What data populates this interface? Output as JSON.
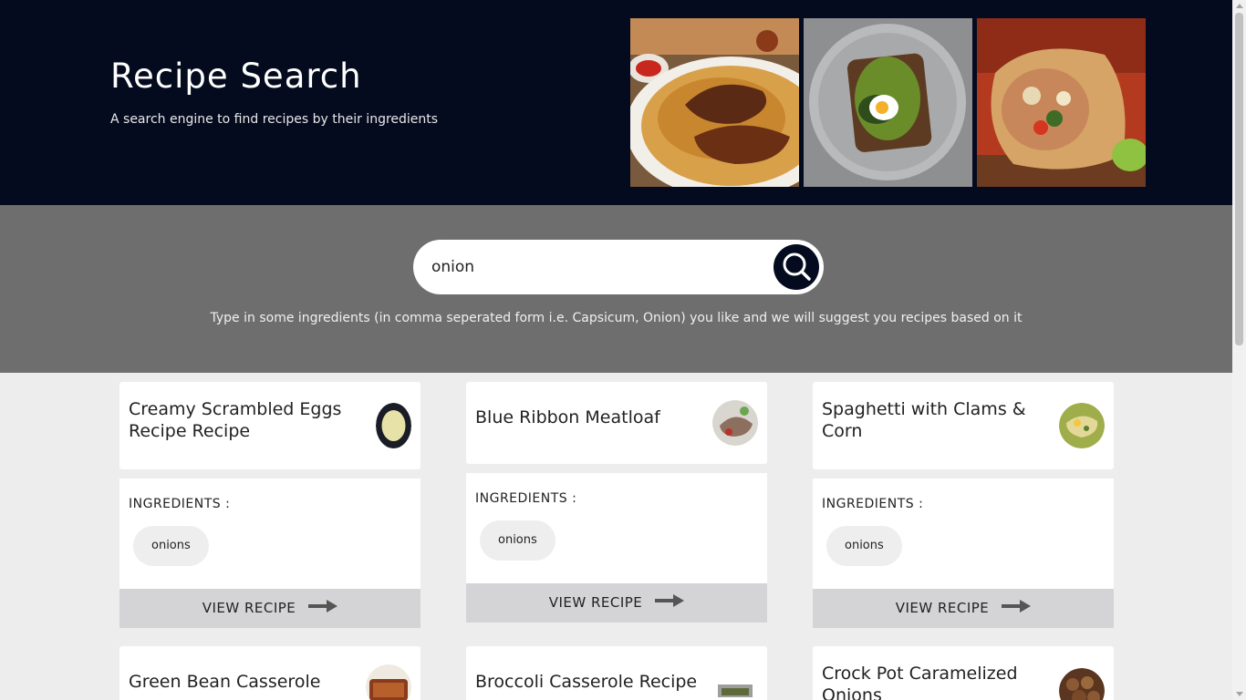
{
  "header": {
    "title": "Recipe Search",
    "subtitle": "A search engine to find recipes by their ingredients",
    "images": [
      "biryani-photo",
      "avocado-toast-photo",
      "burrito-photo"
    ]
  },
  "search": {
    "value": "onion",
    "button_icon": "magnifier-icon",
    "hint": "Type in some ingredients (in comma seperated form i.e. Capsicum, Onion) you like and we will suggest you recipes based on it"
  },
  "recipes": [
    {
      "title": "Creamy Scrambled Eggs Recipe Recipe",
      "ingredients_label": "INGREDIENTS :",
      "ingredients": [
        "onions"
      ],
      "button": "VIEW RECIPE"
    },
    {
      "title": "Blue Ribbon Meatloaf",
      "ingredients_label": "INGREDIENTS :",
      "ingredients": [
        "onions"
      ],
      "button": "VIEW RECIPE"
    },
    {
      "title": "Spaghetti with Clams & Corn",
      "ingredients_label": "INGREDIENTS :",
      "ingredients": [
        "onions"
      ],
      "button": "VIEW RECIPE"
    },
    {
      "title": "Green Bean Casserole"
    },
    {
      "title": "Broccoli Casserole Recipe"
    },
    {
      "title": "Crock Pot Caramelized Onions"
    }
  ],
  "colors": {
    "header_bg": "#040b1e",
    "search_band_bg": "#6e6e6e",
    "page_bg": "#ededed",
    "button_bg": "#d4d4d6"
  }
}
